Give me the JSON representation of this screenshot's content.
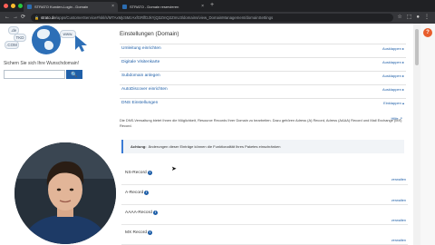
{
  "browser": {
    "traffic_lights": [
      "#ff5f57",
      "#febc2e",
      "#28c840"
    ],
    "tabs": [
      {
        "title": "STRATO Kunden-Login - Domain",
        "active": true
      },
      {
        "title": "STRATO - Domain reservieren",
        "active": false
      }
    ],
    "url_host": "strato.de",
    "url_path": "/apps/CustomerService#/skl/s/MTAxMjc5MzAxfGRlfDJkYjQ3ZmQ2ZmU3/domains/view_DomainManagement/domainSettings",
    "new_tab": "+",
    "nav": {
      "back": "←",
      "forward": "→",
      "reload": "⟳"
    },
    "icons": [
      "star-icon",
      "extension-icon",
      "profile-icon",
      "menu-icon"
    ]
  },
  "left_panel": {
    "bubbles": [
      "www.",
      ".de",
      "TKD",
      ".COM"
    ],
    "tagline": "Sichern Sie sich Ihre Wunschdomain!",
    "search_placeholder": "",
    "search_icon": "🔍"
  },
  "content": {
    "section_title": "Einstellungen (Domain)",
    "rows": [
      {
        "label": "Umleitung einrichten",
        "action": "Ausklappen ▸"
      },
      {
        "label": "Digitale Visitenkarte",
        "action": "Ausklappen ▸"
      },
      {
        "label": "Subdomain anlegen",
        "action": "Ausklappen ▸"
      },
      {
        "label": "AutoDiscover einrichten",
        "action": "Ausklappen ▸"
      },
      {
        "label": "DNS Einstellungen",
        "action": "Einklappen ▴"
      }
    ],
    "help_link": "Hilfe ↗",
    "description": "Die DNS-Verwaltung bietet Ihnen die Möglichkeit, Resource Records Ihrer Domain zu bearbeiten. Dazu gehören Adress (A) Record, Adress (AAAA) Record und Mail Exchange (MX) Record.",
    "warning_label": "Achtung:",
    "warning_text": "Änderungen dieser Einträge können die Funktionalität Ihres Paketes einschränken",
    "records": [
      {
        "name": "NS-Record",
        "edit": "verwalten"
      },
      {
        "name": "A-Record",
        "edit": "verwalten"
      },
      {
        "name": "AAAA-Record",
        "edit": "verwalten"
      },
      {
        "name": "MX Record",
        "edit": "verwalten"
      }
    ]
  },
  "help_badge": "?"
}
